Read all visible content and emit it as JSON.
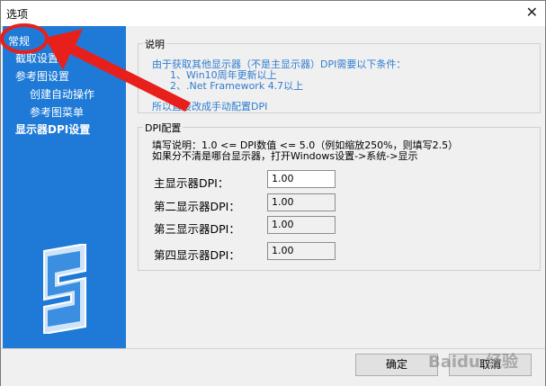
{
  "window": {
    "title": "选项",
    "close_glyph": "✕"
  },
  "sidebar": {
    "items": [
      {
        "label": "常规",
        "bold": false
      },
      {
        "label": "截取设置",
        "bold": false
      },
      {
        "label": "参考图设置",
        "bold": false
      },
      {
        "label": "创建自动操作",
        "bold": false
      },
      {
        "label": "参考图菜单",
        "bold": false
      },
      {
        "label": "显示器DPI设置",
        "bold": true
      }
    ]
  },
  "info": {
    "legend": "说明",
    "line1": "由于获取其他显示器（不是主显示器）DPI需要以下条件：",
    "line2": "1、Win10周年更新以上",
    "line3": "2、.Net Framework 4.7以上",
    "line4": "所以直接改成手动配置DPI"
  },
  "dpi": {
    "legend": "DPI配置",
    "note1": "填写说明：1.0 <= DPI数值 <= 5.0（例如缩放250%，则填写2.5）",
    "note2": "如果分不清是哪台显示器，打开Windows设置->系统->显示",
    "fields": [
      {
        "label": "主显示器DPI：",
        "value": "1.00"
      },
      {
        "label": "第二显示器DPI：",
        "value": "1.00"
      },
      {
        "label": "第三显示器DPI：",
        "value": "1.00"
      },
      {
        "label": "第四显示器DPI：",
        "value": "1.00"
      }
    ]
  },
  "buttons": {
    "ok": "确定",
    "cancel": "取消"
  },
  "watermark": "Baidu 经验",
  "colors": {
    "sidebar": "#1e7ad6",
    "info_text": "#2f7dd0",
    "annotation": "#e8201c"
  }
}
